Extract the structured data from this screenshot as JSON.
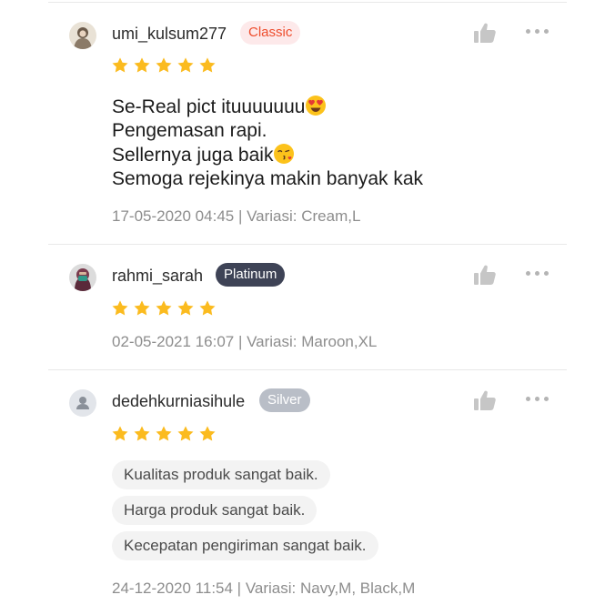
{
  "reviews": [
    {
      "username": "umi_kulsum277",
      "badge": "Classic",
      "rating": 5,
      "comment_lines": [
        "Se-Real pict ituuuuuuu",
        "Pengemasan rapi.",
        "Sellernya juga baik",
        "Semoga rejekinya makin banyak kak"
      ],
      "meta": "17-05-2020 04:45 | Variasi: Cream,L"
    },
    {
      "username": "rahmi_sarah",
      "badge": "Platinum",
      "rating": 5,
      "meta": "02-05-2021 16:07 | Variasi: Maroon,XL"
    },
    {
      "username": "dedehkurniasihule",
      "badge": "Silver",
      "rating": 5,
      "tags": [
        "Kualitas produk sangat baik.",
        "Harga produk sangat baik.",
        "Kecepatan pengiriman sangat baik."
      ],
      "meta": "24-12-2020 11:54 | Variasi: Navy,M, Black,M"
    }
  ],
  "icons": {
    "like": "thumbs-up-icon",
    "more": "more-options-icon",
    "star": "star-icon"
  },
  "colors": {
    "star": "#fbbb1f",
    "classic_badge_text": "#ee4d2d",
    "classic_badge_bg": "#fde9ea",
    "platinum_badge_bg": "#3e4356",
    "silver_badge_bg": "#b9bec7",
    "meta_text": "#8d8d8d"
  }
}
